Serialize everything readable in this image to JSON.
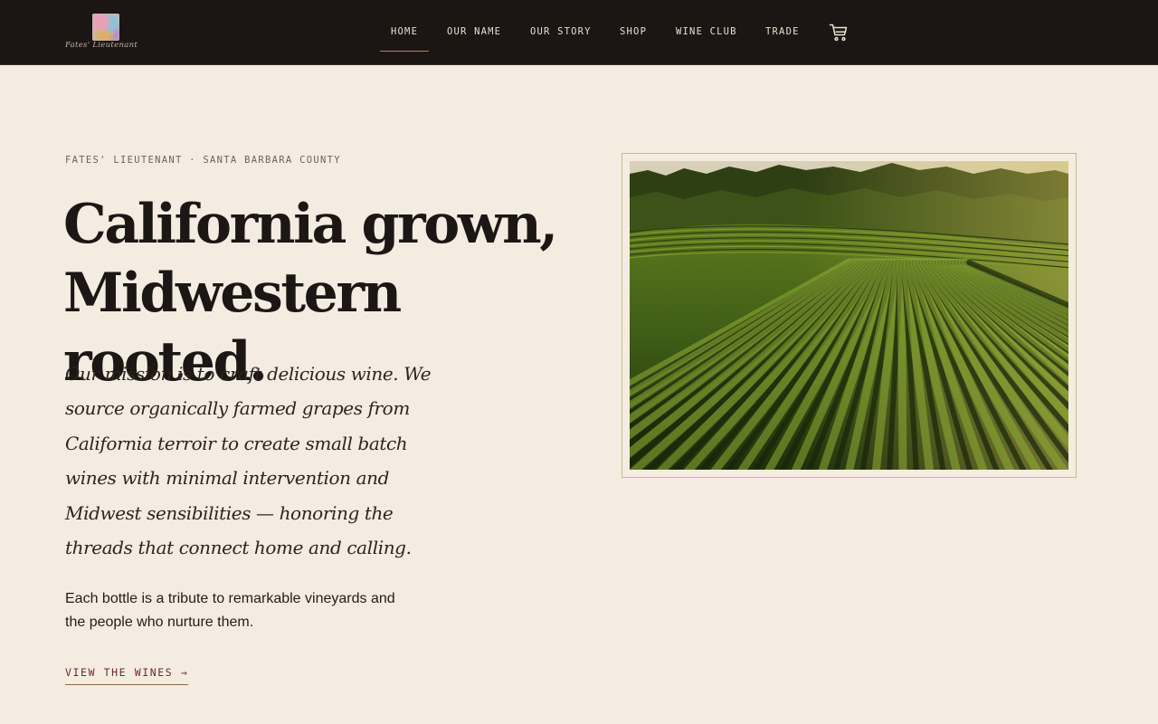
{
  "header": {
    "logo_text": "Fates' Lieutenant",
    "nav": [
      {
        "label": "HOME",
        "active": true
      },
      {
        "label": "OUR NAME"
      },
      {
        "label": "OUR STORY"
      },
      {
        "label": "SHOP"
      },
      {
        "label": "WINE CLUB"
      },
      {
        "label": "TRADE"
      }
    ],
    "cart_icon": "shopping-cart-icon"
  },
  "hero": {
    "eyebrow": "FATES' LIEUTENANT · SANTA BARBARA COUNTY",
    "headline_line1": "California grown,",
    "headline_line2": "Midwestern rooted.",
    "mission": "Our mission is to craft delicious wine. We source organically farmed grapes from California terroir to create small batch wines with minimal intervention and Midwest sensibilities — honoring the threads that connect home and calling.",
    "tribute": "Each bottle is a tribute to remarkable vineyards and the people who nurture them.",
    "cta_label": "VIEW THE WINES →",
    "image_subject": "aerial view of vineyard rows"
  },
  "colors": {
    "header_bg": "#1b1613",
    "page_bg": "#f4ece0",
    "accent_underline": "#a8895d",
    "cta_text": "#6b2a24",
    "frame_border": "#cbb896"
  }
}
